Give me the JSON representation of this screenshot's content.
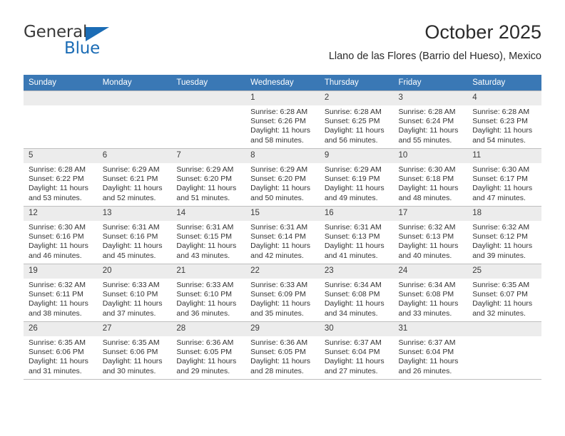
{
  "brand": {
    "name_part1": "General",
    "name_part2": "Blue",
    "logo_icon": "triangle-logo-icon"
  },
  "header": {
    "title": "October 2025",
    "subtitle": "Llano de las Flores (Barrio del Hueso), Mexico"
  },
  "colors": {
    "header_blue": "#3a78b5",
    "brand_blue": "#1b6cb5",
    "daynum_band": "#ececec",
    "grid_line": "#bfbfbf"
  },
  "weekdays": [
    "Sunday",
    "Monday",
    "Tuesday",
    "Wednesday",
    "Thursday",
    "Friday",
    "Saturday"
  ],
  "labels": {
    "sunrise_prefix": "Sunrise:",
    "sunset_prefix": "Sunset:",
    "daylight_prefix": "Daylight:"
  },
  "weeks": [
    [
      {
        "day": "",
        "empty": true
      },
      {
        "day": "",
        "empty": true
      },
      {
        "day": "",
        "empty": true
      },
      {
        "day": "1",
        "sunrise": "Sunrise: 6:28 AM",
        "sunset": "Sunset: 6:26 PM",
        "daylight_l1": "Daylight: 11 hours",
        "daylight_l2": "and 58 minutes."
      },
      {
        "day": "2",
        "sunrise": "Sunrise: 6:28 AM",
        "sunset": "Sunset: 6:25 PM",
        "daylight_l1": "Daylight: 11 hours",
        "daylight_l2": "and 56 minutes."
      },
      {
        "day": "3",
        "sunrise": "Sunrise: 6:28 AM",
        "sunset": "Sunset: 6:24 PM",
        "daylight_l1": "Daylight: 11 hours",
        "daylight_l2": "and 55 minutes."
      },
      {
        "day": "4",
        "sunrise": "Sunrise: 6:28 AM",
        "sunset": "Sunset: 6:23 PM",
        "daylight_l1": "Daylight: 11 hours",
        "daylight_l2": "and 54 minutes."
      }
    ],
    [
      {
        "day": "5",
        "sunrise": "Sunrise: 6:28 AM",
        "sunset": "Sunset: 6:22 PM",
        "daylight_l1": "Daylight: 11 hours",
        "daylight_l2": "and 53 minutes."
      },
      {
        "day": "6",
        "sunrise": "Sunrise: 6:29 AM",
        "sunset": "Sunset: 6:21 PM",
        "daylight_l1": "Daylight: 11 hours",
        "daylight_l2": "and 52 minutes."
      },
      {
        "day": "7",
        "sunrise": "Sunrise: 6:29 AM",
        "sunset": "Sunset: 6:20 PM",
        "daylight_l1": "Daylight: 11 hours",
        "daylight_l2": "and 51 minutes."
      },
      {
        "day": "8",
        "sunrise": "Sunrise: 6:29 AM",
        "sunset": "Sunset: 6:20 PM",
        "daylight_l1": "Daylight: 11 hours",
        "daylight_l2": "and 50 minutes."
      },
      {
        "day": "9",
        "sunrise": "Sunrise: 6:29 AM",
        "sunset": "Sunset: 6:19 PM",
        "daylight_l1": "Daylight: 11 hours",
        "daylight_l2": "and 49 minutes."
      },
      {
        "day": "10",
        "sunrise": "Sunrise: 6:30 AM",
        "sunset": "Sunset: 6:18 PM",
        "daylight_l1": "Daylight: 11 hours",
        "daylight_l2": "and 48 minutes."
      },
      {
        "day": "11",
        "sunrise": "Sunrise: 6:30 AM",
        "sunset": "Sunset: 6:17 PM",
        "daylight_l1": "Daylight: 11 hours",
        "daylight_l2": "and 47 minutes."
      }
    ],
    [
      {
        "day": "12",
        "sunrise": "Sunrise: 6:30 AM",
        "sunset": "Sunset: 6:16 PM",
        "daylight_l1": "Daylight: 11 hours",
        "daylight_l2": "and 46 minutes."
      },
      {
        "day": "13",
        "sunrise": "Sunrise: 6:31 AM",
        "sunset": "Sunset: 6:16 PM",
        "daylight_l1": "Daylight: 11 hours",
        "daylight_l2": "and 45 minutes."
      },
      {
        "day": "14",
        "sunrise": "Sunrise: 6:31 AM",
        "sunset": "Sunset: 6:15 PM",
        "daylight_l1": "Daylight: 11 hours",
        "daylight_l2": "and 43 minutes."
      },
      {
        "day": "15",
        "sunrise": "Sunrise: 6:31 AM",
        "sunset": "Sunset: 6:14 PM",
        "daylight_l1": "Daylight: 11 hours",
        "daylight_l2": "and 42 minutes."
      },
      {
        "day": "16",
        "sunrise": "Sunrise: 6:31 AM",
        "sunset": "Sunset: 6:13 PM",
        "daylight_l1": "Daylight: 11 hours",
        "daylight_l2": "and 41 minutes."
      },
      {
        "day": "17",
        "sunrise": "Sunrise: 6:32 AM",
        "sunset": "Sunset: 6:13 PM",
        "daylight_l1": "Daylight: 11 hours",
        "daylight_l2": "and 40 minutes."
      },
      {
        "day": "18",
        "sunrise": "Sunrise: 6:32 AM",
        "sunset": "Sunset: 6:12 PM",
        "daylight_l1": "Daylight: 11 hours",
        "daylight_l2": "and 39 minutes."
      }
    ],
    [
      {
        "day": "19",
        "sunrise": "Sunrise: 6:32 AM",
        "sunset": "Sunset: 6:11 PM",
        "daylight_l1": "Daylight: 11 hours",
        "daylight_l2": "and 38 minutes."
      },
      {
        "day": "20",
        "sunrise": "Sunrise: 6:33 AM",
        "sunset": "Sunset: 6:10 PM",
        "daylight_l1": "Daylight: 11 hours",
        "daylight_l2": "and 37 minutes."
      },
      {
        "day": "21",
        "sunrise": "Sunrise: 6:33 AM",
        "sunset": "Sunset: 6:10 PM",
        "daylight_l1": "Daylight: 11 hours",
        "daylight_l2": "and 36 minutes."
      },
      {
        "day": "22",
        "sunrise": "Sunrise: 6:33 AM",
        "sunset": "Sunset: 6:09 PM",
        "daylight_l1": "Daylight: 11 hours",
        "daylight_l2": "and 35 minutes."
      },
      {
        "day": "23",
        "sunrise": "Sunrise: 6:34 AM",
        "sunset": "Sunset: 6:08 PM",
        "daylight_l1": "Daylight: 11 hours",
        "daylight_l2": "and 34 minutes."
      },
      {
        "day": "24",
        "sunrise": "Sunrise: 6:34 AM",
        "sunset": "Sunset: 6:08 PM",
        "daylight_l1": "Daylight: 11 hours",
        "daylight_l2": "and 33 minutes."
      },
      {
        "day": "25",
        "sunrise": "Sunrise: 6:35 AM",
        "sunset": "Sunset: 6:07 PM",
        "daylight_l1": "Daylight: 11 hours",
        "daylight_l2": "and 32 minutes."
      }
    ],
    [
      {
        "day": "26",
        "sunrise": "Sunrise: 6:35 AM",
        "sunset": "Sunset: 6:06 PM",
        "daylight_l1": "Daylight: 11 hours",
        "daylight_l2": "and 31 minutes."
      },
      {
        "day": "27",
        "sunrise": "Sunrise: 6:35 AM",
        "sunset": "Sunset: 6:06 PM",
        "daylight_l1": "Daylight: 11 hours",
        "daylight_l2": "and 30 minutes."
      },
      {
        "day": "28",
        "sunrise": "Sunrise: 6:36 AM",
        "sunset": "Sunset: 6:05 PM",
        "daylight_l1": "Daylight: 11 hours",
        "daylight_l2": "and 29 minutes."
      },
      {
        "day": "29",
        "sunrise": "Sunrise: 6:36 AM",
        "sunset": "Sunset: 6:05 PM",
        "daylight_l1": "Daylight: 11 hours",
        "daylight_l2": "and 28 minutes."
      },
      {
        "day": "30",
        "sunrise": "Sunrise: 6:37 AM",
        "sunset": "Sunset: 6:04 PM",
        "daylight_l1": "Daylight: 11 hours",
        "daylight_l2": "and 27 minutes."
      },
      {
        "day": "31",
        "sunrise": "Sunrise: 6:37 AM",
        "sunset": "Sunset: 6:04 PM",
        "daylight_l1": "Daylight: 11 hours",
        "daylight_l2": "and 26 minutes."
      },
      {
        "day": "",
        "empty": true
      }
    ]
  ]
}
